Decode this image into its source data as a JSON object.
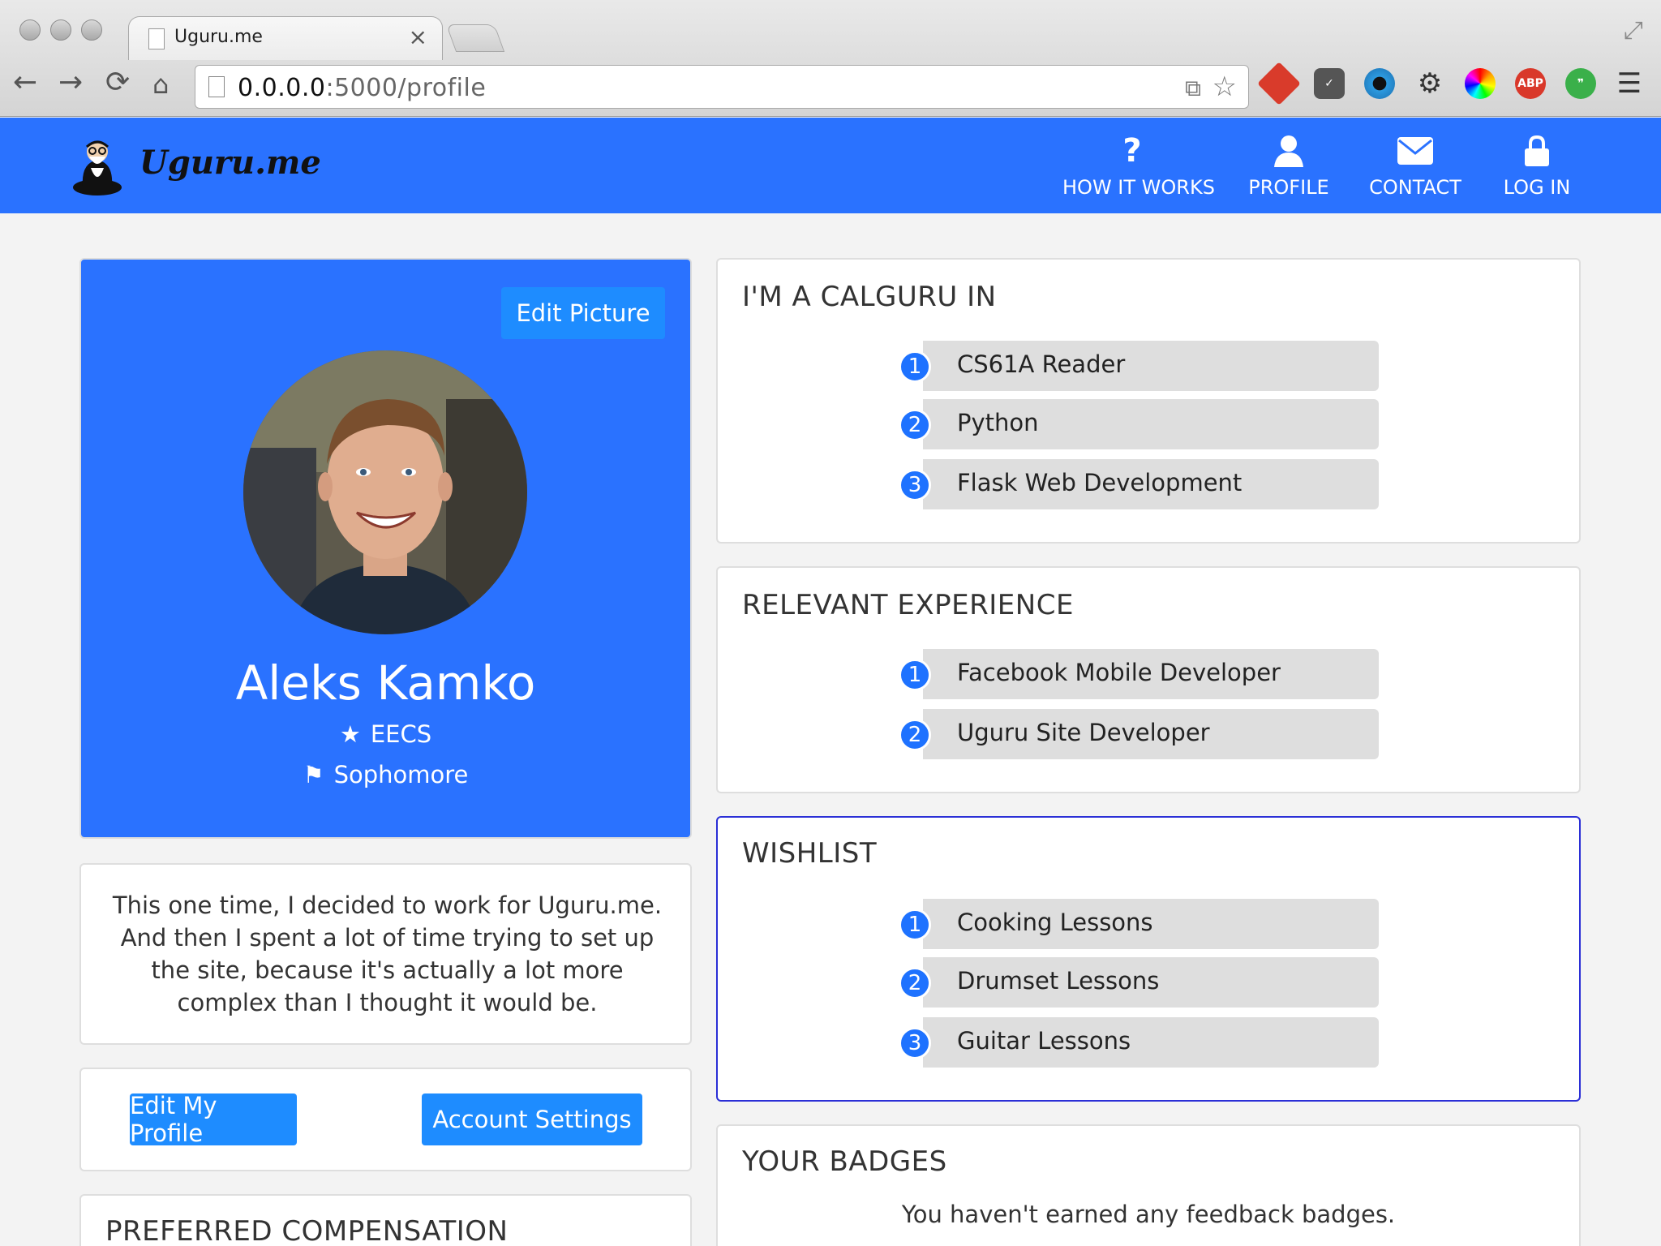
{
  "browser": {
    "tab_title": "Uguru.me",
    "tab_close": "×",
    "url_host": "0.0.0.0",
    "url_rest": ":5000/profile",
    "extensions": [
      "extension-red-burst-icon",
      "pocket-icon",
      "eye-icon",
      "gear-icon",
      "color-wheel-icon",
      "adblock-icon",
      "chat-icon"
    ],
    "adblock_label": "ABP"
  },
  "site": {
    "logo_text": "Uguru.me",
    "nav": [
      {
        "label": "HOW IT WORKS",
        "icon": "question-icon"
      },
      {
        "label": "PROFILE",
        "icon": "user-icon"
      },
      {
        "label": "CONTACT",
        "icon": "envelope-icon"
      },
      {
        "label": "LOG IN",
        "icon": "lock-icon"
      }
    ],
    "brand_color": "#2a72ff"
  },
  "profile": {
    "edit_picture": "Edit Picture",
    "name": "Aleks Kamko",
    "major": "EECS",
    "year": "Sophomore",
    "bio": "This one time, I decided to work for Uguru.me. And then I spent a lot of time trying to set up the site, because it's actually a lot more complex than I thought it would be.",
    "edit_profile": "Edit My Profile",
    "account_settings": "Account Settings",
    "compensation_title": "PREFERRED COMPENSATION"
  },
  "sections": {
    "calguru": {
      "title": "I'M A CALGURU IN",
      "items": [
        {
          "num": "1",
          "label": "CS61A Reader"
        },
        {
          "num": "2",
          "label": "Python"
        },
        {
          "num": "3",
          "label": "Flask Web Development"
        }
      ]
    },
    "experience": {
      "title": "RELEVANT EXPERIENCE",
      "items": [
        {
          "num": "1",
          "label": "Facebook Mobile Developer"
        },
        {
          "num": "2",
          "label": "Uguru Site Developer"
        }
      ]
    },
    "wishlist": {
      "title": "WISHLIST",
      "items": [
        {
          "num": "1",
          "label": "Cooking Lessons"
        },
        {
          "num": "2",
          "label": "Drumset Lessons"
        },
        {
          "num": "3",
          "label": "Guitar Lessons"
        }
      ]
    },
    "badges": {
      "title": "YOUR BADGES",
      "empty_text": "You haven't earned any feedback badges."
    }
  }
}
